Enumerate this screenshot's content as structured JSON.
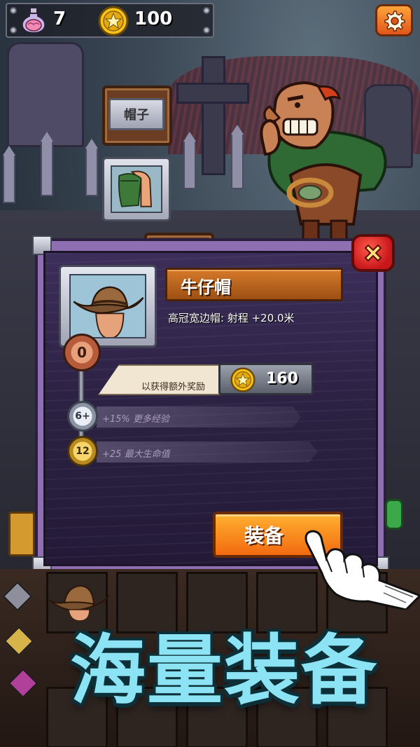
{
  "hud": {
    "potion_icon": "brain-potion-icon",
    "potion_count": "7",
    "coin_icon": "star-coin-icon",
    "coin_count": "100",
    "settings_icon": "gear-icon"
  },
  "slots": {
    "hat_label": "帽子"
  },
  "modal": {
    "close_icon": "close-x-icon",
    "item_name": "牛仔帽",
    "item_desc": "高冠宽边帽: 射程 +20.0米",
    "level": "0",
    "bonus_prompt": "以获得额外奖励",
    "price": "160",
    "tiers": [
      {
        "badge": "6+",
        "text": "+15% 更多经验",
        "badge_style": "silver"
      },
      {
        "badge": "12",
        "text": "+25 最大生命值",
        "badge_style": "gold"
      }
    ],
    "equip_label": "装备"
  },
  "promo": {
    "headline": "海量装备"
  },
  "colors": {
    "accent_orange": "#f26a10",
    "promo_cyan": "#8be3f3",
    "panel_purple": "#8e6fb2",
    "close_red": "#c8171b"
  }
}
